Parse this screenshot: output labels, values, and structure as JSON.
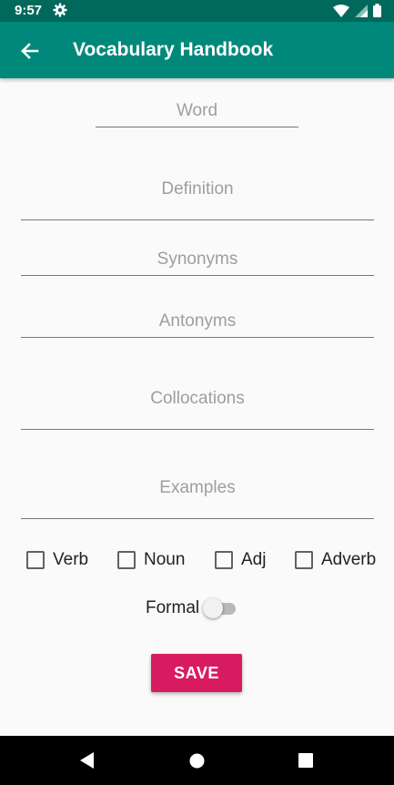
{
  "status_bar": {
    "time": "9:57"
  },
  "app_bar": {
    "title": "Vocabulary Handbook"
  },
  "form": {
    "word_hint": "Word",
    "definition_hint": "Definition",
    "synonyms_hint": "Synonyms",
    "antonyms_hint": "Antonyms",
    "collocations_hint": "Collocations",
    "examples_hint": "Examples"
  },
  "checkboxes": [
    {
      "label": "Verb",
      "checked": false
    },
    {
      "label": "Noun",
      "checked": false
    },
    {
      "label": "Adj",
      "checked": false
    },
    {
      "label": "Adverb",
      "checked": false
    }
  ],
  "formal": {
    "label": "Formal",
    "on": false
  },
  "save_label": "SAVE",
  "colors": {
    "status_bar": "#00695c",
    "app_bar": "#00897b",
    "save_button": "#d81b60",
    "background": "#fafafa"
  },
  "icons": [
    "gear-icon",
    "wifi-icon",
    "signal-icon",
    "battery-icon",
    "back-arrow-icon",
    "nav-back-icon",
    "nav-home-icon",
    "nav-recents-icon"
  ]
}
